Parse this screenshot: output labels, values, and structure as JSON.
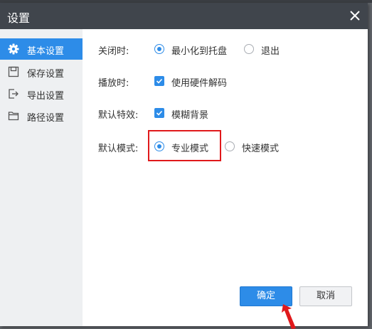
{
  "window": {
    "title": "设置"
  },
  "sidebar": {
    "items": [
      {
        "label": "基本设置",
        "icon": "gear-icon",
        "active": true
      },
      {
        "label": "保存设置",
        "icon": "save-icon",
        "active": false
      },
      {
        "label": "导出设置",
        "icon": "export-icon",
        "active": false
      },
      {
        "label": "路径设置",
        "icon": "folder-icon",
        "active": false
      }
    ]
  },
  "settings": {
    "close_behavior": {
      "label": "关闭时:",
      "options": [
        {
          "label": "最小化到托盘",
          "selected": true
        },
        {
          "label": "退出",
          "selected": false
        }
      ]
    },
    "playback": {
      "label": "播放时:",
      "checkbox": {
        "label": "使用硬件解码",
        "checked": true
      }
    },
    "default_effect": {
      "label": "默认特效:",
      "checkbox": {
        "label": "模糊背景",
        "checked": true
      }
    },
    "default_mode": {
      "label": "默认模式:",
      "options": [
        {
          "label": "专业模式",
          "selected": true
        },
        {
          "label": "快速模式",
          "selected": false
        }
      ]
    }
  },
  "buttons": {
    "ok": "确定",
    "cancel": "取消"
  },
  "colors": {
    "accent": "#2d8ce8",
    "titlebar": "#40454c",
    "highlight": "#e0191b",
    "sidebar_bg": "#eef0f2"
  }
}
